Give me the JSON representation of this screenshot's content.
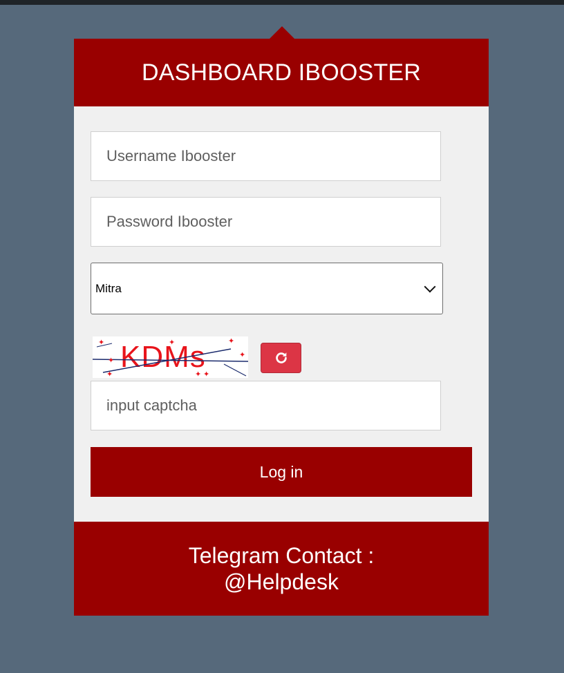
{
  "header": {
    "title": "DASHBOARD IBOOSTER"
  },
  "form": {
    "username_placeholder": "Username Ibooster",
    "password_placeholder": "Password Ibooster",
    "partner_select": {
      "selected": "Mitra"
    },
    "captcha": {
      "text": "KDMs"
    },
    "captcha_placeholder": "input captcha",
    "login_label": "Log in"
  },
  "footer": {
    "line1": "Telegram Contact :",
    "line2": "@Helpdesk"
  },
  "colors": {
    "brand": "#990000",
    "background": "#56697b",
    "panel": "#f0f0f0",
    "refresh": "#dc3545"
  },
  "icons": {
    "refresh": "refresh-icon",
    "dropdown": "chevron-down-icon"
  }
}
